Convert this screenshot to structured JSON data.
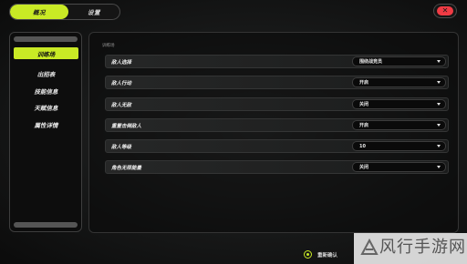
{
  "tabs": [
    {
      "label": "概况",
      "active": true
    },
    {
      "label": "设置",
      "active": false
    }
  ],
  "close_icon": "close-icon",
  "accent_color": "#c9ea25",
  "close_color": "#ef3b44",
  "sidemenu": {
    "items": [
      {
        "label": "训练场",
        "active": true
      },
      {
        "label": "出招表",
        "active": false
      },
      {
        "label": "技能信息",
        "active": false
      },
      {
        "label": "天赋信息",
        "active": false
      },
      {
        "label": "属性详情",
        "active": false
      }
    ]
  },
  "main": {
    "section_title": "训练场",
    "rows": [
      {
        "label": "敌人选择",
        "value": "围绕战竞员"
      },
      {
        "label": "敌人行动",
        "value": "开启"
      },
      {
        "label": "敌人无敌",
        "value": "关闭"
      },
      {
        "label": "重置击倒敌人",
        "value": "开启"
      },
      {
        "label": "敌人等级",
        "value": "10"
      },
      {
        "label": "角色无限能量",
        "value": "关闭"
      }
    ]
  },
  "footer": {
    "confirm_label": "重新确认"
  },
  "watermark": {
    "text": "风行手游网"
  }
}
